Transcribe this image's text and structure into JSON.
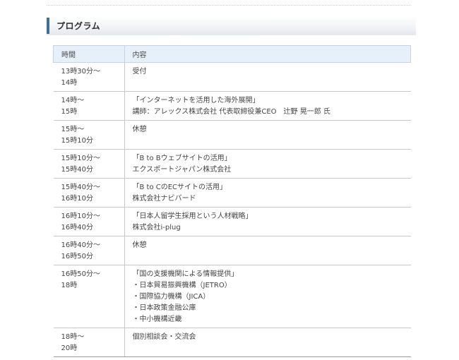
{
  "section": {
    "title": "プログラム"
  },
  "table": {
    "headers": {
      "time": "時間",
      "content": "内容"
    },
    "rows": [
      {
        "time": [
          "13時30分～",
          "14時"
        ],
        "content": [
          "受付"
        ]
      },
      {
        "time": [
          "14時～",
          "15時"
        ],
        "content": [
          "「インターネットを活用した海外展開」",
          "講師：アレックス株式会社 代表取締役兼CEO　辻野 晃一郎 氏"
        ]
      },
      {
        "time": [
          "15時～",
          "15時10分"
        ],
        "content": [
          "休憩"
        ]
      },
      {
        "time": [
          "15時10分～",
          "15時40分"
        ],
        "content": [
          "「B to Bウェブサイトの活用」",
          "エクスポートジャパン株式会社"
        ]
      },
      {
        "time": [
          "15時40分～",
          "16時10分"
        ],
        "content": [
          "「B to CのECサイトの活用」",
          "株式会社ナビバード"
        ]
      },
      {
        "time": [
          "16時10分～",
          "16時40分"
        ],
        "content": [
          "「日本人留学生採用という人材戦略」",
          "株式会社i-plug"
        ]
      },
      {
        "time": [
          "16時40分～",
          "16時50分"
        ],
        "content": [
          "休憩"
        ]
      },
      {
        "time": [
          "16時50分～",
          "18時"
        ],
        "content": [
          "「国の支援機関による情報提供」",
          "・日本貿易振興機構（JETRO）",
          "・国際協力機構（JICA）",
          "・日本政策金融公庫",
          "・中小機構近畿"
        ]
      },
      {
        "time": [
          "18時～",
          "20時"
        ],
        "content": [
          "個別相談会・交流会"
        ]
      }
    ]
  }
}
